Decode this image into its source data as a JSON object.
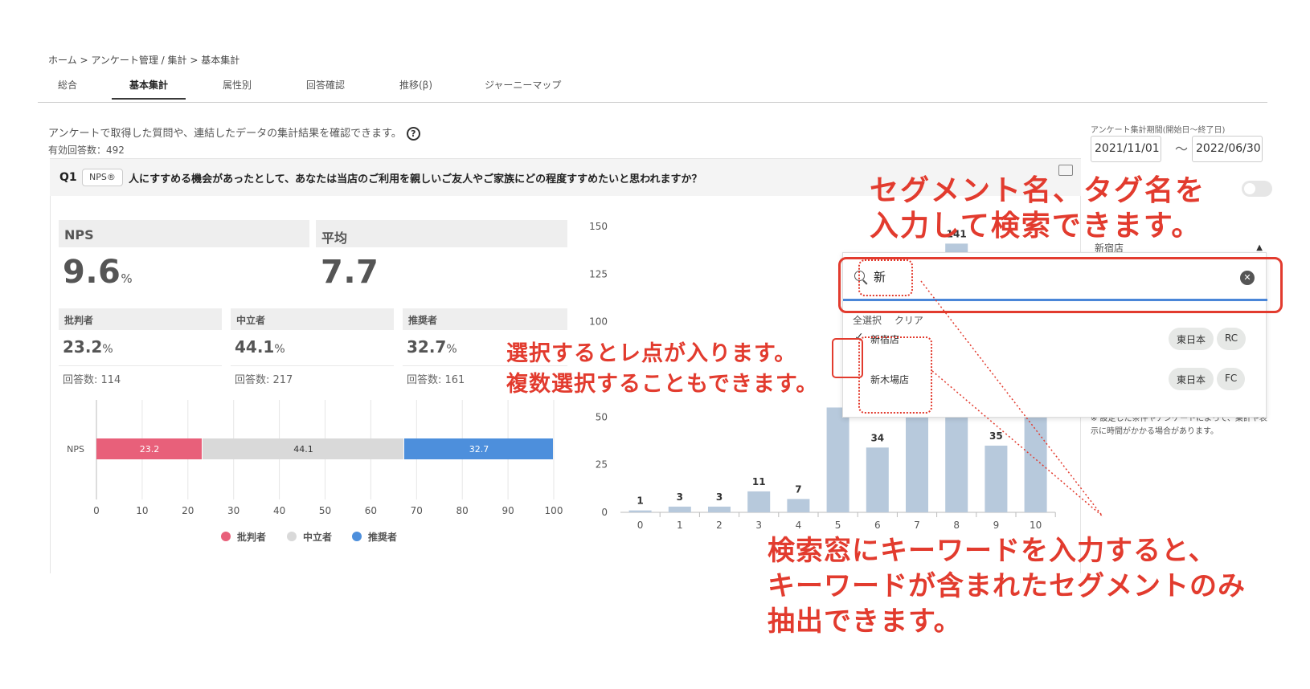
{
  "breadcrumb": "ホーム > アンケート管理 / 集計 > 基本集計",
  "tabs": [
    {
      "label": "総合"
    },
    {
      "label": "基本集計"
    },
    {
      "label": "属性別"
    },
    {
      "label": "回答確認"
    },
    {
      "label": "推移(β)"
    },
    {
      "label": "ジャーニーマップ"
    }
  ],
  "intro": "アンケートで取得した質問や、連結したデータの集計結果を確認できます。",
  "help_icon": "?",
  "valid_count": "有効回答数：492",
  "question": {
    "number": "Q1",
    "badge": "NPS®",
    "text": "人にすすめる機会があったとして、あなたは当店のご利用を親しいご友人やご家族にどの程度すすめたいと思われますか？"
  },
  "kpi": {
    "nps": {
      "label": "NPS",
      "value": "9.6",
      "unit": "%"
    },
    "avg": {
      "label": "平均",
      "value": "7.7"
    },
    "groups": [
      {
        "label": "批判者",
        "value": "23.2",
        "unit": "%",
        "count": "回答数: 114"
      },
      {
        "label": "中立者",
        "value": "44.1",
        "unit": "%",
        "count": "回答数: 217"
      },
      {
        "label": "推奨者",
        "value": "32.7",
        "unit": "%",
        "count": "回答数: 161"
      }
    ]
  },
  "filter": {
    "period_label": "アンケート集計期間(開始日〜終了日)",
    "start": "2021/11/01",
    "tilde": "〜",
    "end": "2022/06/30",
    "segment_selected": "新宿店",
    "note": "※ 設定した条件やアンケートによって、集計や表示に時間がかかる場合があります。"
  },
  "dropdown": {
    "query": "新",
    "select_all": "全選択",
    "clear": "クリア",
    "options": [
      {
        "label": "新宿店",
        "checked": true,
        "tags": [
          "東日本",
          "RC"
        ]
      },
      {
        "label": "新木場店",
        "checked": false,
        "tags": [
          "東日本",
          "FC"
        ]
      }
    ]
  },
  "annotations": {
    "top": [
      "セグメント名、タグ名を",
      "入力して検索できます。"
    ],
    "middle": [
      "選択するとレ点が入ります。",
      "複数選択することもできます。"
    ],
    "bottom": [
      "検索窓にキーワードを入力すると、",
      "キーワードが含まれたセグメントのみ",
      "抽出できます。"
    ]
  },
  "chart_data": [
    {
      "type": "bar",
      "orientation": "horizontal-stacked",
      "categories": [
        "NPS"
      ],
      "series": [
        {
          "name": "批判者",
          "values": [
            23.2
          ],
          "color": "#e8607a"
        },
        {
          "name": "中立者",
          "values": [
            44.1
          ],
          "color": "#d9d9d9"
        },
        {
          "name": "推奨者",
          "values": [
            32.7
          ],
          "color": "#4d8fdc"
        }
      ],
      "xlim": [
        0,
        100
      ],
      "xticks": [
        0,
        10,
        20,
        30,
        40,
        50,
        60,
        70,
        80,
        90,
        100
      ],
      "legend": "bottom",
      "grid": true
    },
    {
      "type": "bar",
      "categories": [
        "0",
        "1",
        "2",
        "3",
        "4",
        "5",
        "6",
        "7",
        "8",
        "9",
        "10"
      ],
      "values": [
        1,
        3,
        3,
        11,
        7,
        55,
        34,
        90,
        141,
        35,
        121
      ],
      "visible_labels": {
        "0": "1",
        "1": "3",
        "2": "3",
        "3": "11",
        "4": "7",
        "6": "34",
        "8": "141",
        "9": "35"
      },
      "ylim": [
        0,
        150
      ],
      "yticks": [
        0,
        25,
        50,
        100,
        125,
        150
      ],
      "color": "#b7c9dc"
    }
  ]
}
